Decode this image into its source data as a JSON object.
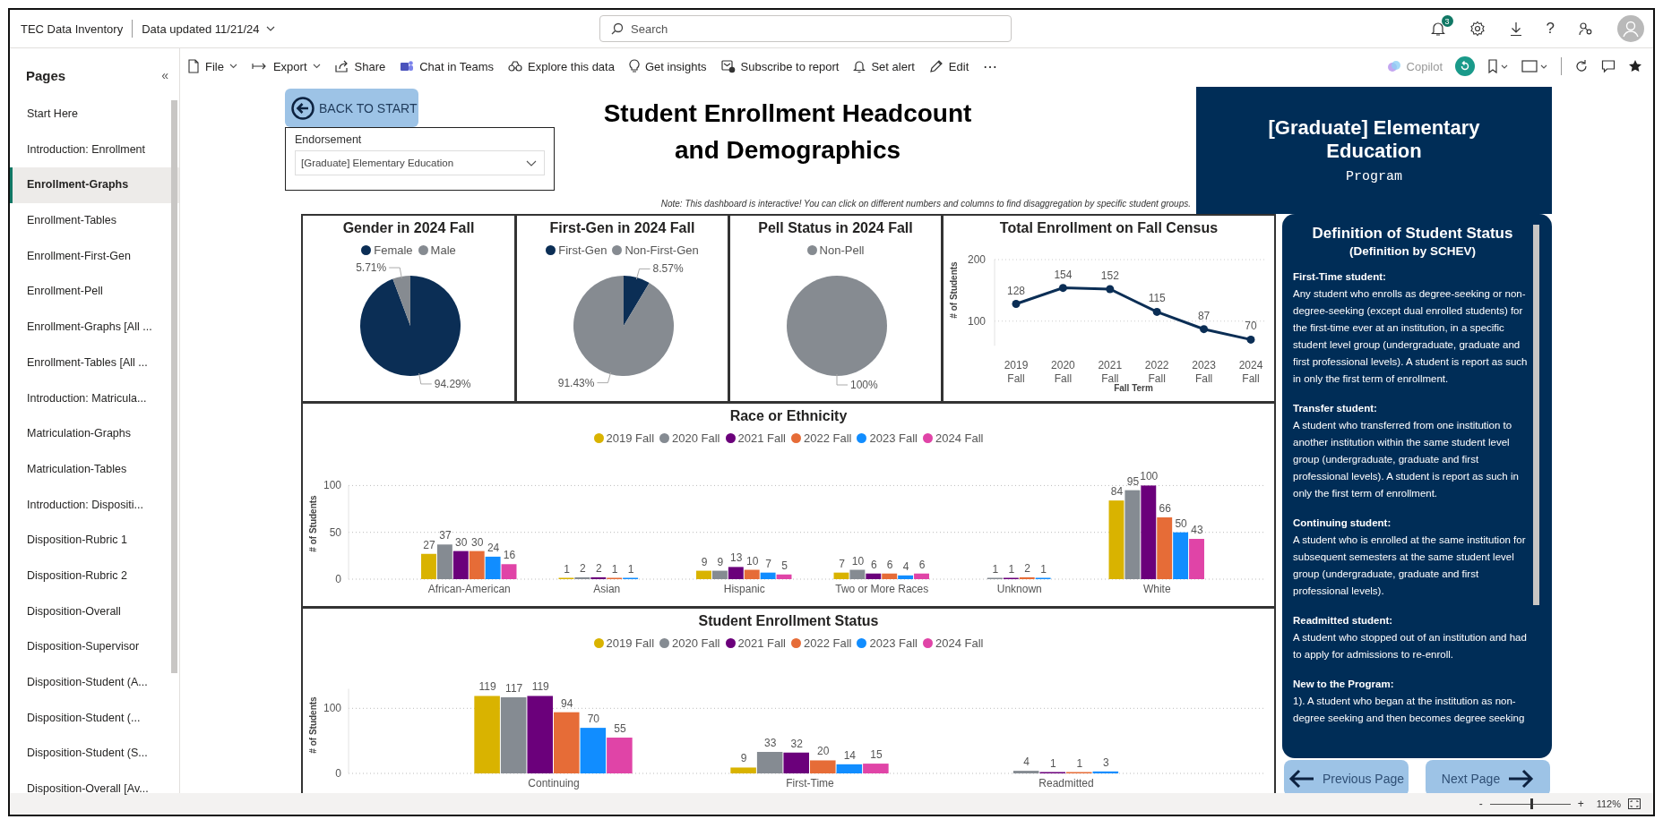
{
  "app_bar": {
    "title": "TEC Data Inventory",
    "updated": "Data updated 11/21/24",
    "search": {
      "placeholder": "Search"
    },
    "notification_count": "3",
    "help": "?"
  },
  "sidebar": {
    "title": "Pages",
    "collapse": "«",
    "items": [
      {
        "label": "Start Here",
        "selected": false
      },
      {
        "label": "Introduction: Enrollment",
        "selected": false
      },
      {
        "label": "Enrollment-Graphs",
        "selected": true
      },
      {
        "label": "Enrollment-Tables",
        "selected": false
      },
      {
        "label": "Enrollment-First-Gen",
        "selected": false
      },
      {
        "label": "Enrollment-Pell",
        "selected": false
      },
      {
        "label": "Enrollment-Graphs [All ...",
        "selected": false
      },
      {
        "label": "Enrollment-Tables [All ...",
        "selected": false
      },
      {
        "label": "Introduction: Matricula...",
        "selected": false
      },
      {
        "label": "Matriculation-Graphs",
        "selected": false
      },
      {
        "label": "Matriculation-Tables",
        "selected": false
      },
      {
        "label": "Introduction: Dispositi...",
        "selected": false
      },
      {
        "label": "Disposition-Rubric 1",
        "selected": false
      },
      {
        "label": "Disposition-Rubric 2",
        "selected": false
      },
      {
        "label": "Disposition-Overall",
        "selected": false
      },
      {
        "label": "Disposition-Supervisor",
        "selected": false
      },
      {
        "label": "Disposition-Student (A...",
        "selected": false
      },
      {
        "label": "Disposition-Student (...",
        "selected": false
      },
      {
        "label": "Disposition-Student (S...",
        "selected": false
      },
      {
        "label": "Disposition-Overall [Av...",
        "selected": false
      }
    ]
  },
  "toolbar": {
    "items": [
      {
        "label": "File",
        "dropdown": true
      },
      {
        "label": "Export",
        "dropdown": true
      },
      {
        "label": "Share",
        "dropdown": false
      },
      {
        "label": "Chat in Teams",
        "dropdown": false
      },
      {
        "label": "Explore this data",
        "dropdown": false
      },
      {
        "label": "Get insights",
        "dropdown": false
      },
      {
        "label": "Subscribe to report",
        "dropdown": false
      },
      {
        "label": "Set alert",
        "dropdown": false
      },
      {
        "label": "Edit",
        "dropdown": false
      }
    ],
    "more": "⋯",
    "copilot": "Copilot"
  },
  "report": {
    "back_button": "BACK TO START",
    "slicer": {
      "label": "Endorsement",
      "value": "[Graduate] Elementary Education"
    },
    "title_lines": [
      "Student Enrollment Headcount",
      "and Demographics"
    ],
    "note": "Note: This dashboard is interactive! You can click on different numbers and columns to find disaggregation by specific student groups.",
    "program": {
      "name": "[Graduate] Elementary Education",
      "subtitle": "Program"
    },
    "pies": [
      {
        "title": "Gender in 2024 Fall",
        "chart_data": {
          "type": "pie",
          "categories": [
            "Female",
            "Male"
          ],
          "colors": [
            "#0b2e55",
            "#868b91"
          ],
          "values": [
            94.29,
            5.71
          ],
          "value_labels": [
            "94.29%",
            "5.71%"
          ]
        }
      },
      {
        "title": "First-Gen in 2024 Fall",
        "chart_data": {
          "type": "pie",
          "categories": [
            "First-Gen",
            "Non-First-Gen"
          ],
          "colors": [
            "#0b2e55",
            "#868b91"
          ],
          "values": [
            8.57,
            91.43
          ],
          "value_labels": [
            "8.57%",
            "91.43%"
          ]
        }
      },
      {
        "title": "Pell Status in 2024 Fall",
        "chart_data": {
          "type": "pie",
          "categories": [
            "Non-Pell"
          ],
          "colors": [
            "#868b91"
          ],
          "values": [
            100
          ],
          "value_labels": [
            "100%"
          ]
        }
      }
    ],
    "line": {
      "title": "Total Enrollment on Fall Census",
      "chart_data": {
        "type": "line",
        "xlabel": "Fall Term",
        "ylabel": "# of Students",
        "categories": [
          "2019 Fall",
          "2020 Fall",
          "2021 Fall",
          "2022 Fall",
          "2023 Fall",
          "2024 Fall"
        ],
        "series": [
          {
            "color": "#0b2e55",
            "marker": true,
            "values": [
              128,
              154,
              152,
              115,
              87,
              70
            ]
          }
        ],
        "ylim": [
          60,
          200
        ],
        "yticks": [
          100,
          200
        ],
        "data_labels": true
      }
    },
    "race": {
      "title": "Race or Ethnicity",
      "chart_data": {
        "type": "bar",
        "ylabel": "# of Students",
        "categories": [
          "African-American",
          "Asian",
          "Hispanic",
          "Two or More Races",
          "Unknown",
          "White"
        ],
        "series": [
          {
            "name": "2019 Fall",
            "color": "#d9b300",
            "values": [
              27,
              1,
              9,
              7,
              null,
              84
            ]
          },
          {
            "name": "2020 Fall",
            "color": "#858b92",
            "values": [
              37,
              2,
              9,
              10,
              1,
              95
            ]
          },
          {
            "name": "2021 Fall",
            "color": "#6b007b",
            "values": [
              30,
              2,
              13,
              6,
              1,
              100
            ]
          },
          {
            "name": "2022 Fall",
            "color": "#e66c37",
            "values": [
              30,
              1,
              10,
              6,
              2,
              66
            ]
          },
          {
            "name": "2023 Fall",
            "color": "#118dff",
            "values": [
              24,
              1,
              7,
              4,
              1,
              50
            ]
          },
          {
            "name": "2024 Fall",
            "color": "#e044a7",
            "values": [
              16,
              null,
              5,
              6,
              null,
              43
            ]
          }
        ],
        "ylim": [
          0,
          100
        ],
        "yticks": [
          0,
          50,
          100
        ],
        "data_labels": true
      }
    },
    "status": {
      "title": "Student Enrollment Status",
      "chart_data": {
        "type": "bar",
        "ylabel": "# of Students",
        "categories": [
          "Continuing",
          "First-Time",
          "Readmitted"
        ],
        "series": [
          {
            "name": "2019 Fall",
            "color": "#d9b300",
            "values": [
              119,
              9,
              null
            ]
          },
          {
            "name": "2020 Fall",
            "color": "#858b92",
            "values": [
              117,
              33,
              4
            ]
          },
          {
            "name": "2021 Fall",
            "color": "#6b007b",
            "values": [
              119,
              32,
              1
            ]
          },
          {
            "name": "2022 Fall",
            "color": "#e66c37",
            "values": [
              94,
              20,
              1
            ]
          },
          {
            "name": "2023 Fall",
            "color": "#118dff",
            "values": [
              70,
              14,
              3
            ]
          },
          {
            "name": "2024 Fall",
            "color": "#e044a7",
            "values": [
              55,
              15,
              null
            ]
          }
        ],
        "ylim": [
          0,
          130
        ],
        "yticks": [
          0,
          100
        ],
        "data_labels": true
      }
    },
    "definitions": {
      "title": "Definition of Student Status",
      "subtitle": "(Definition by SCHEV)",
      "sections": [
        {
          "heading": "First-Time student:",
          "text": "Any student who enrolls as degree-seeking or non-degree-seeking (except dual enrolled students) for the first-time ever at an institution, in a specific student level group (undergraduate, graduate and first professional levels). A student is report as such in only the first term of enrollment."
        },
        {
          "heading": "Transfer student:",
          "text": "A student who transferred from one institution to another institution within the same student level group (undergraduate, graduate and first professional levels). A student is report as such in only the first term of enrollment."
        },
        {
          "heading": "Continuing student:",
          "text": "A student who is enrolled at the same institution for subsequent semesters at the same student level group (undergraduate, graduate and first professional levels)."
        },
        {
          "heading": "Readmitted student:",
          "text": "A student who stopped out of an institution and had to apply for admissions to re-enroll."
        },
        {
          "heading": "New to the Program:",
          "text": "1). A student who began at the institution as non-degree seeking and then becomes degree seeking"
        }
      ]
    },
    "nav": {
      "previous": "Previous Page",
      "next": "Next Page"
    }
  },
  "status_bar": {
    "zoom": {
      "minus": "-",
      "plus": "+",
      "level": 0.52,
      "reading": "112%"
    }
  }
}
